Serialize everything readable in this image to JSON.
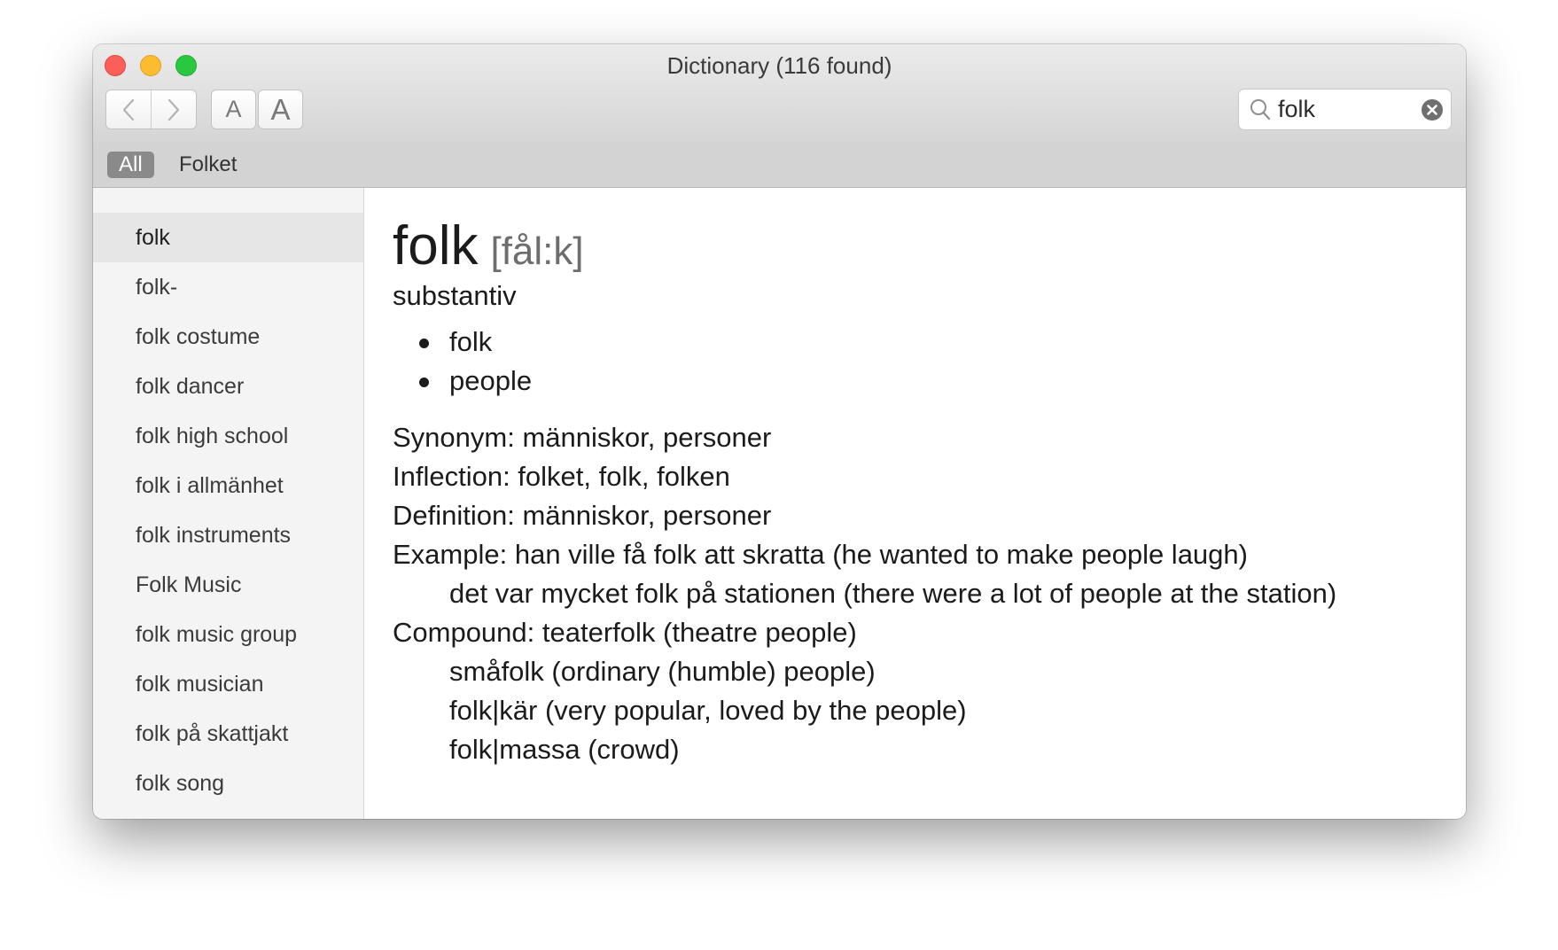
{
  "window": {
    "title": "Dictionary (116 found)"
  },
  "toolbar": {
    "font_smaller_label": "A",
    "font_larger_label": "A"
  },
  "search": {
    "value": "folk"
  },
  "scope": {
    "all_label": "All",
    "folket_label": "Folket"
  },
  "sidebar": {
    "items": [
      "folk",
      "folk-",
      "folk costume",
      "folk dancer",
      "folk high school",
      "folk i allmänhet",
      "folk instruments",
      "Folk Music",
      "folk music group",
      "folk musician",
      "folk på skattjakt",
      "folk song"
    ]
  },
  "entry": {
    "headword": "folk",
    "pronunciation": "[fål:k]",
    "part_of_speech": "substantiv",
    "senses": [
      "folk",
      "people"
    ],
    "synonym": "Synonym: människor, personer",
    "inflection": "Inflection: folket, folk, folken",
    "definition": "Definition: människor, personer",
    "examples": [
      "Example: han ville få folk att skratta (he wanted to make people laugh)",
      "det var mycket folk på stationen (there were a lot of people at the station)"
    ],
    "compounds": [
      "Compound: teaterfolk (theatre people)",
      "småfolk (ordinary (humble) people)",
      "folk|kär (very popular, loved by the people)",
      "folk|massa (crowd)"
    ]
  }
}
